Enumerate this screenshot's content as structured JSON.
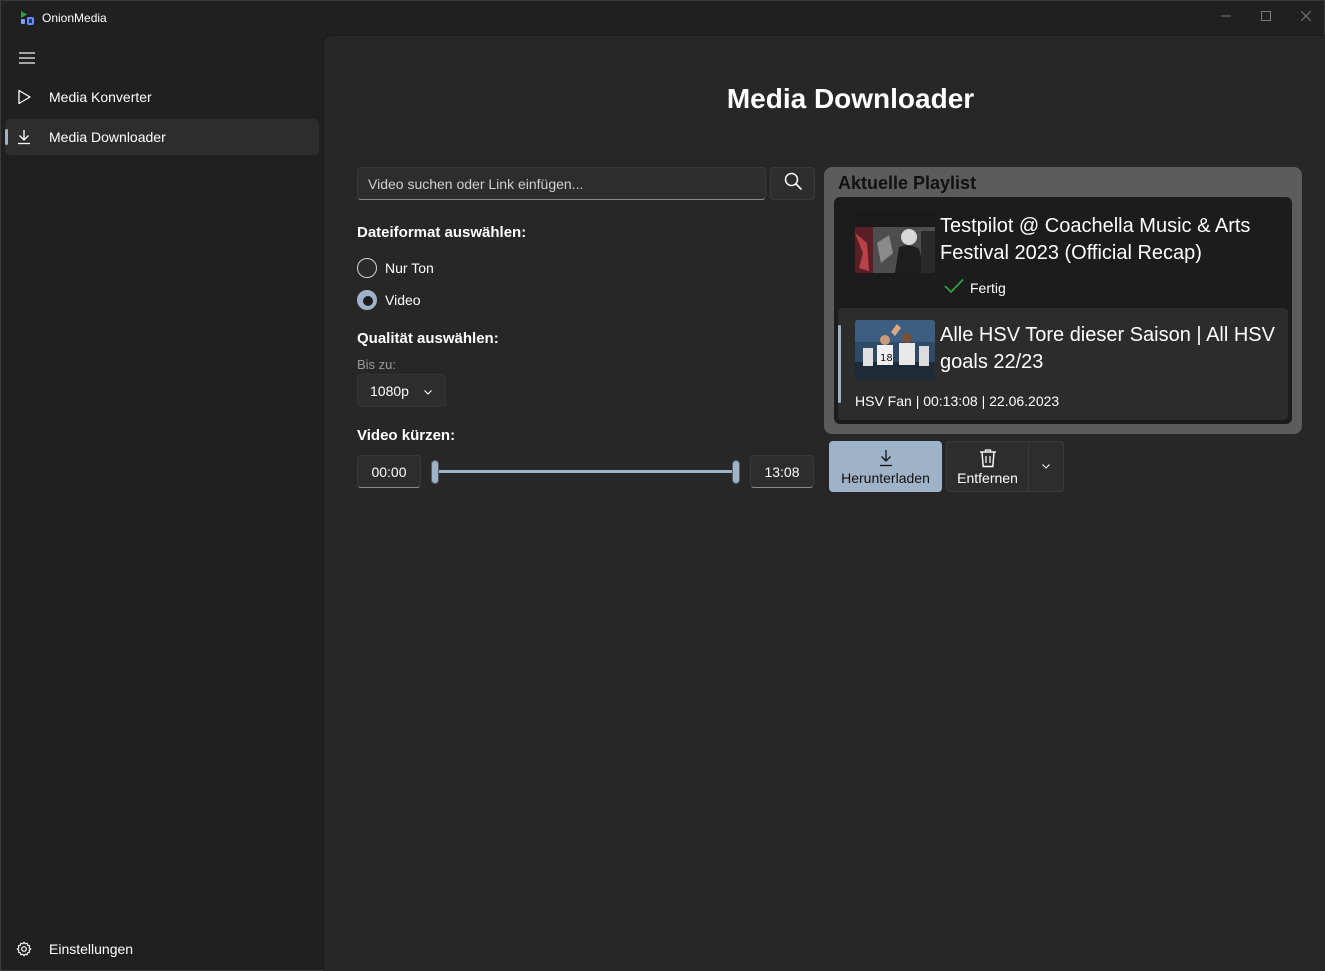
{
  "window": {
    "title": "OnionMedia",
    "controls": {
      "minimize_icon": "minimize-icon",
      "maximize_icon": "maximize-icon",
      "close_icon": "close-icon"
    }
  },
  "sidebar": {
    "menu_icon": "hamburger-icon",
    "items": [
      {
        "label": "Media Konverter",
        "icon": "play-icon",
        "selected": false
      },
      {
        "label": "Media Downloader",
        "icon": "download-icon",
        "selected": true
      }
    ],
    "footer": {
      "label": "Einstellungen",
      "icon": "gear-icon"
    }
  },
  "main": {
    "title": "Media Downloader",
    "search": {
      "placeholder": "Video suchen oder Link einfügen...",
      "value": "",
      "button_icon": "search-icon"
    },
    "format": {
      "label": "Dateiformat auswählen:",
      "options": [
        {
          "label": "Nur Ton",
          "checked": false
        },
        {
          "label": "Video",
          "checked": true
        }
      ]
    },
    "quality": {
      "label": "Qualität auswählen:",
      "sublabel": "Bis zu:",
      "selected": "1080p"
    },
    "trim": {
      "label": "Video kürzen:",
      "start": "00:00",
      "end": "13:08",
      "range_fraction": [
        0,
        1
      ]
    }
  },
  "playlist": {
    "title": "Aktuelle Playlist",
    "items": [
      {
        "title": "Testpilot @ Coachella Music & Arts Festival 2023 (Official Recap)",
        "status": "Fertig",
        "status_icon": "checkmark-icon"
      },
      {
        "title": "Alle HSV Tore dieser Saison | All HSV goals 22/23",
        "meta": "HSV Fan | 00:13:08 | 22.06.2023",
        "selected": true
      }
    ]
  },
  "actions": {
    "download": {
      "label": "Herunterladen",
      "icon": "download-icon"
    },
    "remove": {
      "label": "Entfernen",
      "icon": "trash-icon"
    },
    "more_icon": "chevron-down-icon"
  },
  "colors": {
    "accent": "#9fb3c8",
    "background": "#202020",
    "content": "#272727",
    "success": "#2ea043"
  }
}
